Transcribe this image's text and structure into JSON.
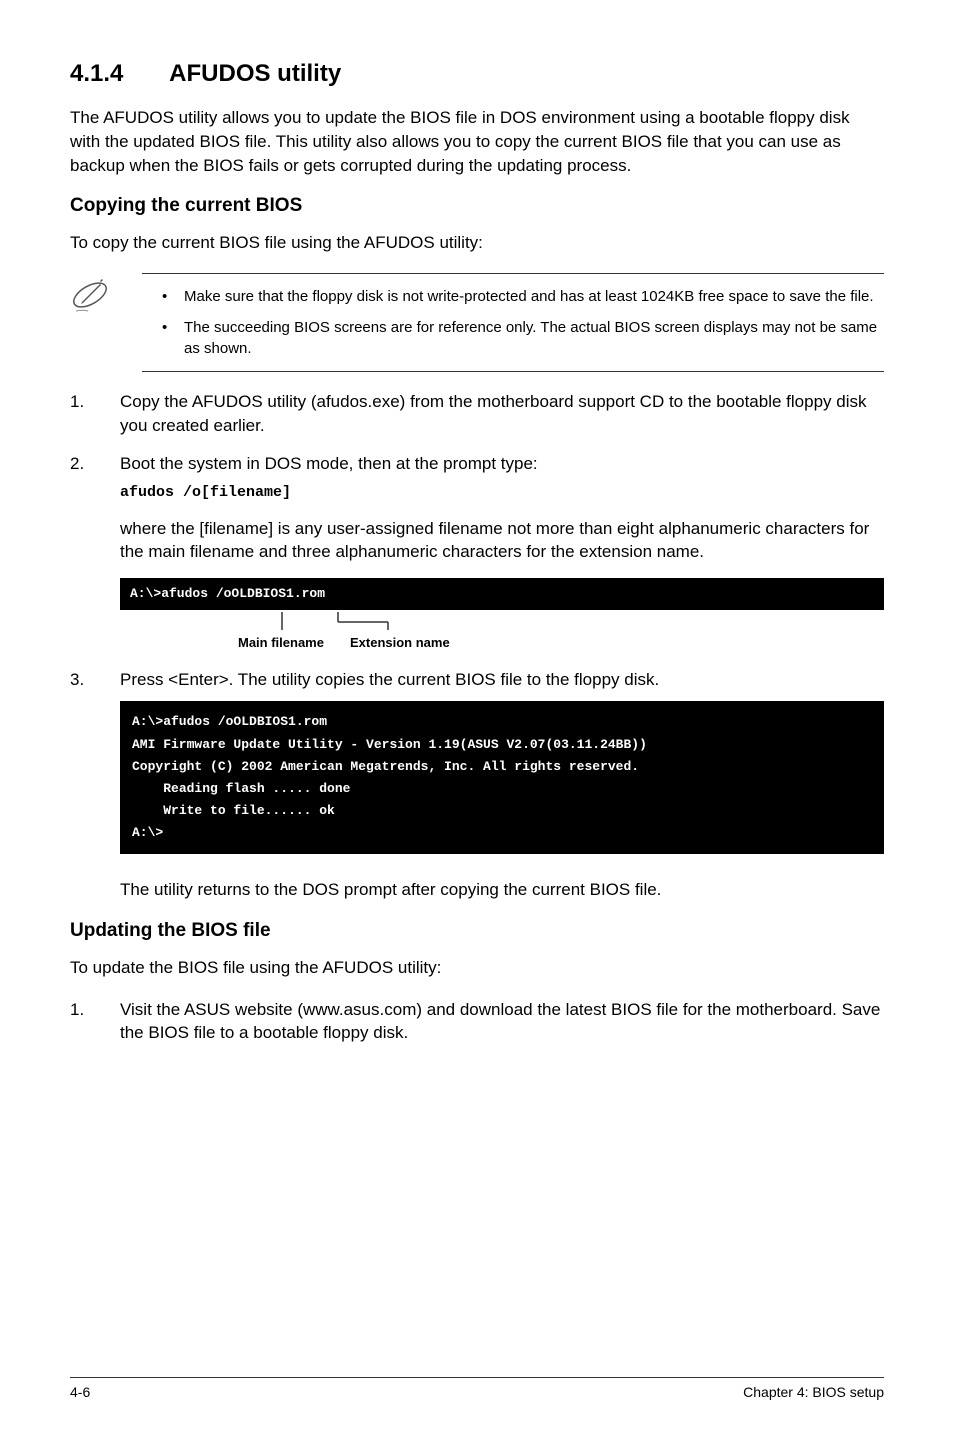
{
  "heading": {
    "number": "4.1.4",
    "title": "AFUDOS utility"
  },
  "intro": "The AFUDOS utility allows you to update the BIOS file in DOS environment using a bootable floppy disk with the updated BIOS file. This utility also allows you to copy the current BIOS file that you can use as backup when the BIOS fails or gets corrupted during the updating process.",
  "copying": {
    "heading": "Copying the current BIOS",
    "lead": "To copy the current BIOS file using the AFUDOS utility:",
    "notes": [
      "Make sure that the floppy disk is not write-protected and has at least 1024KB free space to save the file.",
      "The succeeding BIOS screens are for reference only. The actual BIOS screen displays may not be same as shown."
    ],
    "step1": "Copy the AFUDOS utility (afudos.exe) from the motherboard support CD to the bootable floppy disk you created earlier.",
    "step2": "Boot the system in DOS mode, then at the prompt type:",
    "step2_code": "afudos /o[filename]",
    "step2_para": "where the [filename] is any user-assigned filename not more than eight alphanumeric characters  for the main filename and three alphanumeric characters for the extension name.",
    "terminal1": "A:\\>afudos /oOLDBIOS1.rom",
    "label_main": "Main filename",
    "label_ext": "Extension name",
    "step3": "Press <Enter>. The utility copies the current BIOS file to the floppy disk.",
    "terminal2": "A:\\>afudos /oOLDBIOS1.rom\nAMI Firmware Update Utility - Version 1.19(ASUS V2.07(03.11.24BB))\nCopyright (C) 2002 American Megatrends, Inc. All rights reserved.\n    Reading flash ..... done\n    Write to file...... ok\nA:\\>",
    "post": "The utility returns to the DOS prompt after copying the current BIOS file."
  },
  "updating": {
    "heading": "Updating the BIOS file",
    "lead": "To update the BIOS file using the AFUDOS utility:",
    "step1": "Visit the ASUS website (www.asus.com) and download the latest BIOS file for the motherboard. Save the BIOS file to a bootable floppy disk."
  },
  "footer": {
    "left": "4-6",
    "right": "Chapter 4: BIOS setup"
  }
}
